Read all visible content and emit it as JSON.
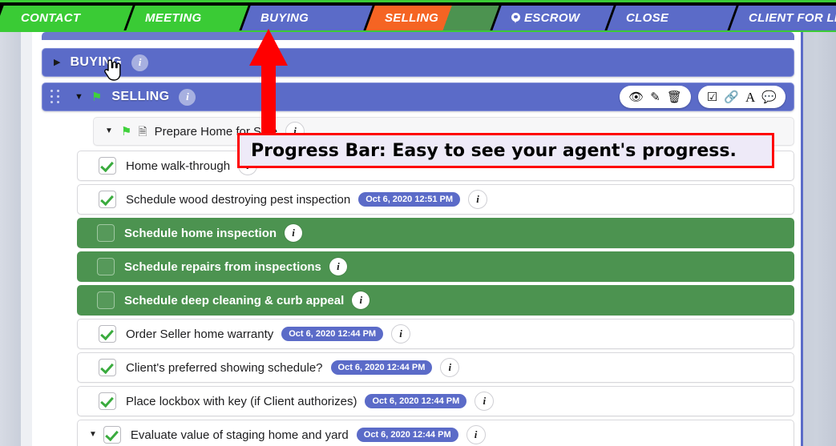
{
  "colors": {
    "accent_purple": "#5b6bc8",
    "done_green": "#3acb35",
    "current_orange": "#f56423",
    "row_green": "#4c9350",
    "annotation_red": "#ff0000",
    "callout_bg": "#eeeaf8"
  },
  "progress_bar": {
    "name": "transaction-progress-bar",
    "stages": [
      {
        "label": "CONTACT",
        "state": "complete",
        "color": "#3acb35",
        "icon": ""
      },
      {
        "label": "MEETING",
        "state": "complete",
        "color": "#3acb35",
        "icon": ""
      },
      {
        "label": "BUYING",
        "state": "upcoming",
        "color": "#5b6bc8",
        "icon": ""
      },
      {
        "label": "SELLING",
        "state": "current",
        "color": "#f56423",
        "icon": ""
      },
      {
        "label": "ESCROW",
        "state": "upcoming",
        "color": "#5b6bc8",
        "icon": "location-pin-icon"
      },
      {
        "label": "CLOSE",
        "state": "upcoming",
        "color": "#5b6bc8",
        "icon": ""
      },
      {
        "label": "CLIENT FOR LIFE",
        "state": "upcoming",
        "color": "#5b6bc8",
        "icon": ""
      }
    ]
  },
  "annotation": {
    "callout_text": "Progress Bar: Easy to see your agent's progress.",
    "arrow": "up-arrow-icon",
    "pointer": "hand-pointer-cursor"
  },
  "stages_list": {
    "buying": {
      "title": "BUYING",
      "caret": "right-caret-icon",
      "info": "i",
      "expanded": false
    },
    "selling": {
      "title": "SELLING",
      "caret": "down-caret-icon",
      "flag": "green-flag-icon",
      "grip": "drag-handle-icon",
      "info": "i",
      "expanded": true,
      "tools_left": [
        {
          "name": "view-icon",
          "glyph": "◉"
        },
        {
          "name": "edit-icon",
          "glyph": "✎"
        },
        {
          "name": "delete-icon",
          "glyph": "Ὕ1"
        }
      ],
      "tools_right": [
        {
          "name": "checklist-icon",
          "glyph": "☑"
        },
        {
          "name": "link-icon",
          "glyph": "⚭"
        },
        {
          "name": "text-icon",
          "glyph": "A"
        },
        {
          "name": "comment-icon",
          "glyph": "●"
        }
      ]
    }
  },
  "group_header": {
    "caret": "down-caret-icon",
    "flag": "green-flag-icon",
    "doc": "document-icon",
    "label": "Prepare Home for Sale",
    "info": "i"
  },
  "tasks": [
    {
      "label": "Home walk-through",
      "checked": true,
      "date": "",
      "highlighted": false,
      "caret": false
    },
    {
      "label": "Schedule wood destroying pest inspection",
      "checked": true,
      "date": "Oct 6, 2020 12:51 PM",
      "highlighted": false,
      "caret": false
    },
    {
      "label": "Schedule home inspection",
      "checked": false,
      "date": "",
      "highlighted": true,
      "caret": false
    },
    {
      "label": "Schedule repairs from inspections",
      "checked": false,
      "date": "",
      "highlighted": true,
      "caret": false
    },
    {
      "label": "Schedule deep cleaning & curb appeal",
      "checked": false,
      "date": "",
      "highlighted": true,
      "caret": false
    },
    {
      "label": "Order Seller home warranty",
      "checked": true,
      "date": "Oct 6, 2020 12:44 PM",
      "highlighted": false,
      "caret": false
    },
    {
      "label": "Client's preferred showing schedule?",
      "checked": true,
      "date": "Oct 6, 2020 12:44 PM",
      "highlighted": false,
      "caret": false
    },
    {
      "label": "Place lockbox with key (if Client authorizes)",
      "checked": true,
      "date": "Oct 6, 2020 12:44 PM",
      "highlighted": false,
      "caret": false
    },
    {
      "label": "Evaluate value of staging home and yard",
      "checked": true,
      "date": "Oct 6, 2020 12:44 PM",
      "highlighted": false,
      "caret": true
    }
  ]
}
